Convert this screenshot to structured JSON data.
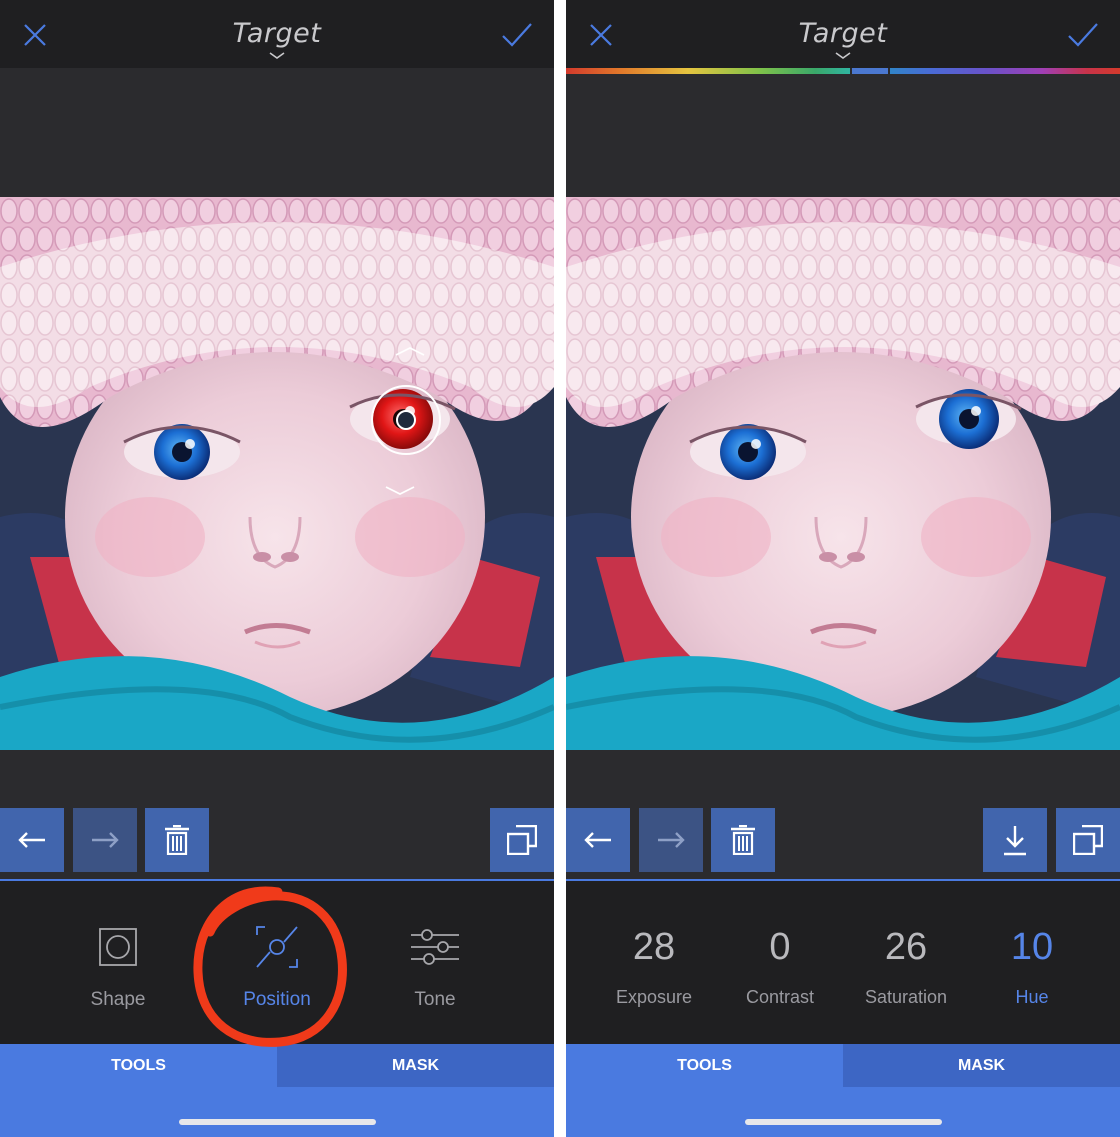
{
  "colors": {
    "accent": "#4a7ae0",
    "button": "#4165ad",
    "topbar": "#1f1f21",
    "panel": "#2b2b2e",
    "annotation": "#f03a1a"
  },
  "left": {
    "header": {
      "title": "Target"
    },
    "tools": [
      {
        "label": "Shape",
        "icon": "shape-icon"
      },
      {
        "label": "Position",
        "icon": "position-icon"
      },
      {
        "label": "Tone",
        "icon": "tone-sliders-icon"
      }
    ],
    "active_tool": "Position",
    "tabs": {
      "tools": "TOOLS",
      "mask": "MASK"
    }
  },
  "right": {
    "header": {
      "title": "Target"
    },
    "params": [
      {
        "value": "28",
        "label": "Exposure"
      },
      {
        "value": "0",
        "label": "Contrast"
      },
      {
        "value": "26",
        "label": "Saturation"
      },
      {
        "value": "10",
        "label": "Hue"
      }
    ],
    "active_param": "Hue",
    "tabs": {
      "tools": "TOOLS",
      "mask": "MASK"
    }
  }
}
